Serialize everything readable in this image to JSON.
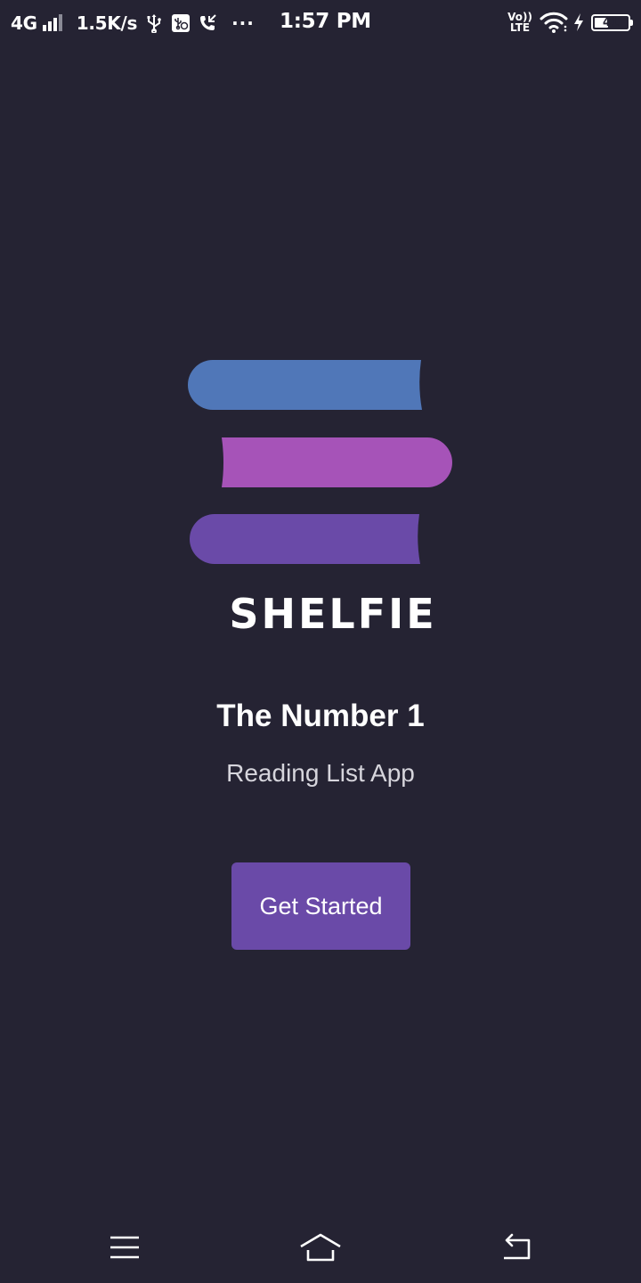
{
  "status_bar": {
    "network": "4G",
    "speed": "1.5K/s",
    "dots": "···",
    "time": "1:57 PM",
    "volte_top": "Vo))",
    "volte_bottom": "LTE",
    "battery_level": "41",
    "battery_fraction": 0.41,
    "icons": [
      "signal-icon",
      "usb-icon",
      "usb-debug-icon",
      "call-icon",
      "wifi-icon",
      "charging-icon",
      "battery-icon"
    ]
  },
  "logo": {
    "brand": "SHELFIE",
    "colors": {
      "book_top": "#5077b8",
      "book_middle": "#a653b8",
      "book_bottom": "#6a4aa8"
    }
  },
  "main": {
    "headline": "The Number 1",
    "subline": "Reading List App",
    "cta_label": "Get Started"
  },
  "nav_bar": {
    "icons": [
      "menu-icon",
      "home-icon",
      "back-icon"
    ]
  },
  "theme": {
    "background": "#252333",
    "accent": "#6a4aa8"
  }
}
